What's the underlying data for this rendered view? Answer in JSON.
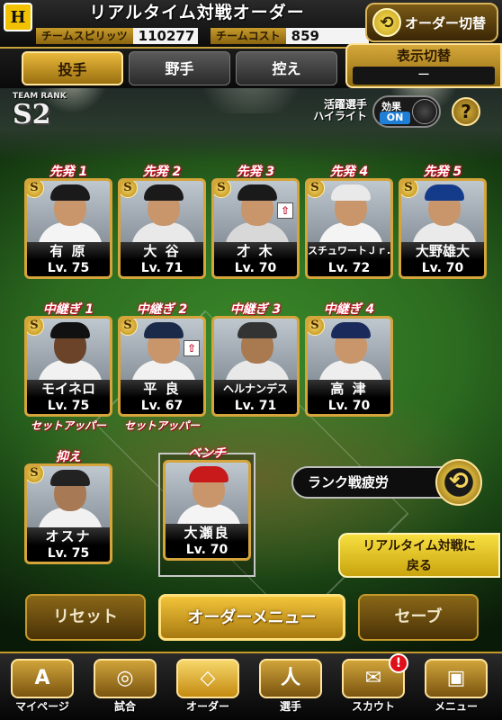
{
  "header": {
    "team_logo_text": "H",
    "title": "リアルタイム対戦オーダー",
    "team_spirit_label": "チームスピリッツ",
    "team_spirit_value": "110277",
    "team_cost_label": "チームコスト",
    "team_cost_value": "859",
    "order_switch_label": "オーダー切替"
  },
  "tabs": [
    {
      "label": "投手",
      "active": true
    },
    {
      "label": "野手",
      "active": false
    },
    {
      "label": "控え",
      "active": false
    }
  ],
  "display_toggle": {
    "label": "表示切替",
    "value": "ー"
  },
  "team_rank": {
    "label": "TEAM RANK",
    "value": "S2"
  },
  "highlight": {
    "label_line1": "活躍選手",
    "label_line2": "ハイライト",
    "effect_label": "効果",
    "effect_value": "ON"
  },
  "help_label": "?",
  "starters": [
    {
      "slot": "先発 1",
      "name": "有 原",
      "level": "Lv. 75",
      "cap": "#1a1a1a",
      "uniform": "#f4f4f4"
    },
    {
      "slot": "先発 2",
      "name": "大 谷",
      "level": "Lv. 71",
      "cap": "#1a1a1a",
      "uniform": "#e9e9e9"
    },
    {
      "slot": "先発 3",
      "name": "才 木",
      "level": "Lv. 70",
      "cap": "#1a1a1a",
      "uniform": "#d8d8d8"
    },
    {
      "slot": "先発 4",
      "name": "スチュワートＪｒ.",
      "level": "Lv. 72",
      "cap": "#e9e9e9",
      "uniform": "#f4f4f4"
    },
    {
      "slot": "先発 5",
      "name": "大野雄大",
      "level": "Lv. 70",
      "cap": "#143a8a",
      "uniform": "#eaeaea"
    }
  ],
  "relievers": [
    {
      "slot": "中継ぎ 1",
      "name": "モイネロ",
      "level": "Lv. 75",
      "role": "セットアッパー",
      "cap": "#111111",
      "uniform": "#f1f1f1"
    },
    {
      "slot": "中継ぎ 2",
      "name": "平 良",
      "level": "Lv. 67",
      "role": "セットアッパー",
      "cap": "#1c2a4a",
      "uniform": "#f1f1f1"
    },
    {
      "slot": "中継ぎ 3",
      "name": "ヘルナンデス",
      "level": "Lv. 71",
      "role": "",
      "cap": "#333333",
      "uniform": "#e8e8e8"
    },
    {
      "slot": "中継ぎ 4",
      "name": "高 津",
      "level": "Lv. 70",
      "role": "",
      "cap": "#1a2a5a",
      "uniform": "#eeeeee"
    }
  ],
  "closer": {
    "slot": "抑え",
    "name": "オスナ",
    "level": "Lv. 75",
    "cap": "#222222",
    "uniform": "#f1f1f1"
  },
  "bench": {
    "slot": "ベンチ",
    "name": "大瀬良",
    "level": "Lv. 70",
    "cap": "#c81a1a",
    "uniform": "#f4f4f4"
  },
  "badges": {
    "s": "S",
    "up": "⇧"
  },
  "rank_fatigue_label": "ランク戦疲労",
  "realtime_back": {
    "line1": "リアルタイム対戦に",
    "line2": "戻る"
  },
  "actions": {
    "reset": "リセット",
    "order_menu": "オーダーメニュー",
    "save": "セーブ"
  },
  "nav": [
    {
      "label": "マイページ",
      "icon": "A"
    },
    {
      "label": "試合",
      "icon": "◎"
    },
    {
      "label": "オーダー",
      "icon": "◇"
    },
    {
      "label": "選手",
      "icon": "人"
    },
    {
      "label": "スカウト",
      "icon": "✉"
    },
    {
      "label": "メニュー",
      "icon": "▣"
    }
  ],
  "notification_count": "!"
}
